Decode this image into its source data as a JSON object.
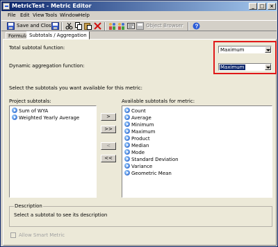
{
  "window": {
    "title": "MetricTest - Metric Editor"
  },
  "title_buttons": {
    "minimize": "_",
    "maximize": "□",
    "close": "×"
  },
  "menu": [
    {
      "label": "File"
    },
    {
      "label": "Edit"
    },
    {
      "label": "View"
    },
    {
      "label": "Tools"
    },
    {
      "label": "Window"
    },
    {
      "label": "Help"
    }
  ],
  "toolbar": {
    "save_close": "Save and Close",
    "object_browser": "Object Browser"
  },
  "tabs": [
    {
      "label": "Formula"
    },
    {
      "label": "Subtotals / Aggregation"
    }
  ],
  "total_subtotal": {
    "label": "Total subtotal function:",
    "value": "Maximum"
  },
  "dynamic_aggregation": {
    "label": "Dynamic aggregation function:",
    "value": "Maximum"
  },
  "instructions": "Select the subtotals you want available for this metric:",
  "project_subtotals": {
    "label": "Project subtotals:",
    "items": [
      "Sum of WYA",
      "Weighted Yearly Average"
    ]
  },
  "available_subtotals": {
    "label": "Available subtotals for metric:",
    "items": [
      "Count",
      "Average",
      "Minimum",
      "Maximum",
      "Product",
      "Median",
      "Mode",
      "Standard Deviation",
      "Variance",
      "Geometric Mean"
    ]
  },
  "move_buttons": {
    "add": ">",
    "add_all": ">>",
    "remove": "<",
    "remove_all": "<<"
  },
  "description": {
    "title": "Description",
    "text": "Select a subtotal to see its description"
  },
  "allow_smart_metric": {
    "label": "Allow Smart Metric",
    "checked": false
  },
  "accent_colors": {
    "title_start": "#0a246a",
    "title_end": "#a6caf0",
    "highlight": "#e01818"
  }
}
